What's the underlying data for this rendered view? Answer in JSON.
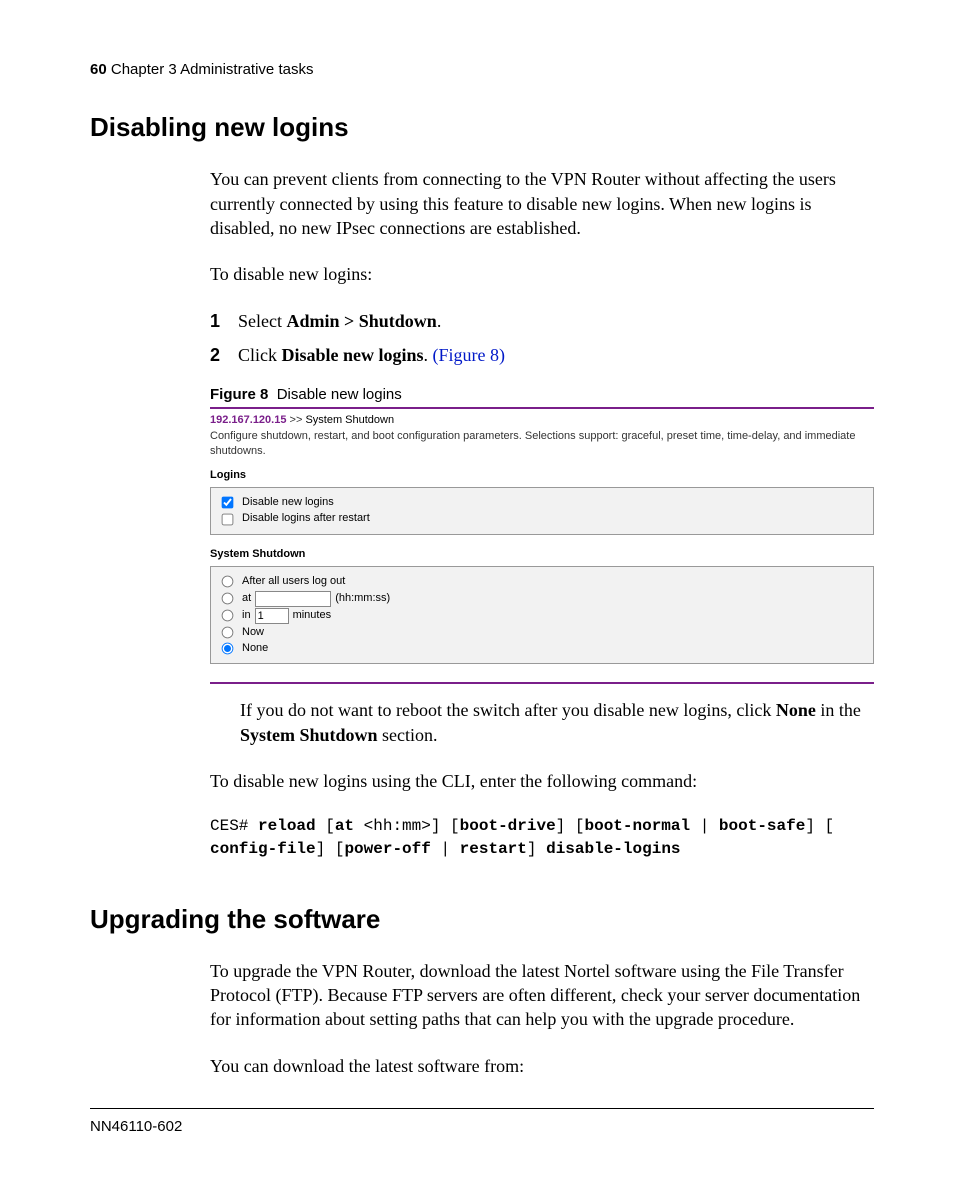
{
  "header": {
    "page_number": "60",
    "chapter": "Chapter 3  Administrative tasks"
  },
  "h1_disabling": "Disabling new logins",
  "p_intro": "You can prevent clients from connecting to the VPN Router without affecting the users currently connected by using this feature to disable new logins. When new logins is disabled, no new IPsec connections are established.",
  "p_to_disable": "To disable new logins:",
  "steps": [
    {
      "num": "1",
      "pre": "Select ",
      "bold": "Admin > Shutdown",
      "post": "."
    },
    {
      "num": "2",
      "pre": "Click ",
      "bold": "Disable new logins",
      "post": ". ",
      "link": "(Figure 8)"
    }
  ],
  "figcap_label": "Figure 8",
  "figcap_title": "Disable new logins",
  "figure": {
    "ip": "192.167.120.15",
    "sep": ">>",
    "crumb_page": "System Shutdown",
    "desc": "Configure shutdown, restart, and boot configuration parameters. Selections support: graceful, preset time, time-delay, and immediate shutdowns.",
    "logins_label": "Logins",
    "cb_disable_new": "Disable new logins",
    "cb_disable_after": "Disable logins after restart",
    "shutdown_label": "System Shutdown",
    "radio_after": "After all users log out",
    "radio_at": "at",
    "at_suffix": "(hh:mm:ss)",
    "radio_in": "in",
    "in_value": "1",
    "in_suffix": "minutes",
    "radio_now": "Now",
    "radio_none": "None"
  },
  "note_pre": "If you do not want to reboot the switch after you disable new logins, click ",
  "note_b1": "None",
  "note_mid": " in the ",
  "note_b2": "System Shutdown",
  "note_post": " section.",
  "p_cli_intro": "To disable new logins using the CLI, enter the following command:",
  "cli": {
    "prompt": "CES# ",
    "reload": "reload",
    "lb1": " [",
    "at": "at",
    "athh": " <hh:mm>] [",
    "bootdrive": "boot-drive",
    "rb1": "] [",
    "bootnormal": "boot-normal",
    "pipe1": " | ",
    "bootsafe": "boot-safe",
    "rb2": "] [",
    "configfile": "config-file",
    "rb3": "] [",
    "poweroff": "power-off",
    "pipe2": " | ",
    "restart": "restart",
    "rb4": "] ",
    "disablelogins": "disable-logins"
  },
  "h1_upgrading": "Upgrading the software",
  "p_upgrade": "To upgrade the VPN Router, download the latest Nortel software using the File Transfer Protocol (FTP). Because FTP servers are often different, check your server documentation for information about setting paths that can help you with the upgrade procedure.",
  "p_download": "You can download the latest software from:",
  "footer_doc": "NN46110-602"
}
